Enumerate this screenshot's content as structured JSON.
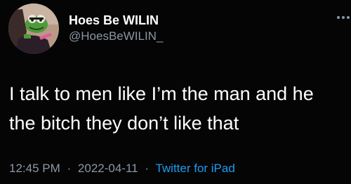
{
  "tweet": {
    "display_name": "Hoes Be WILIN",
    "handle": "@HoesBeWILIN_",
    "text_lines": [
      "I talk to men like I’m the man and he",
      "the bitch they don’t like that"
    ],
    "time": "12:45 PM",
    "date": "2022-04-11",
    "separator": "·",
    "source": "Twitter for iPad"
  },
  "icons": {
    "avatar": "kermit-avatar",
    "more": "more-options-icon"
  },
  "colors": {
    "background": "#050505",
    "primary_text": "#ffffff",
    "secondary_text": "#8b98a5",
    "link": "#1d9bf0"
  }
}
